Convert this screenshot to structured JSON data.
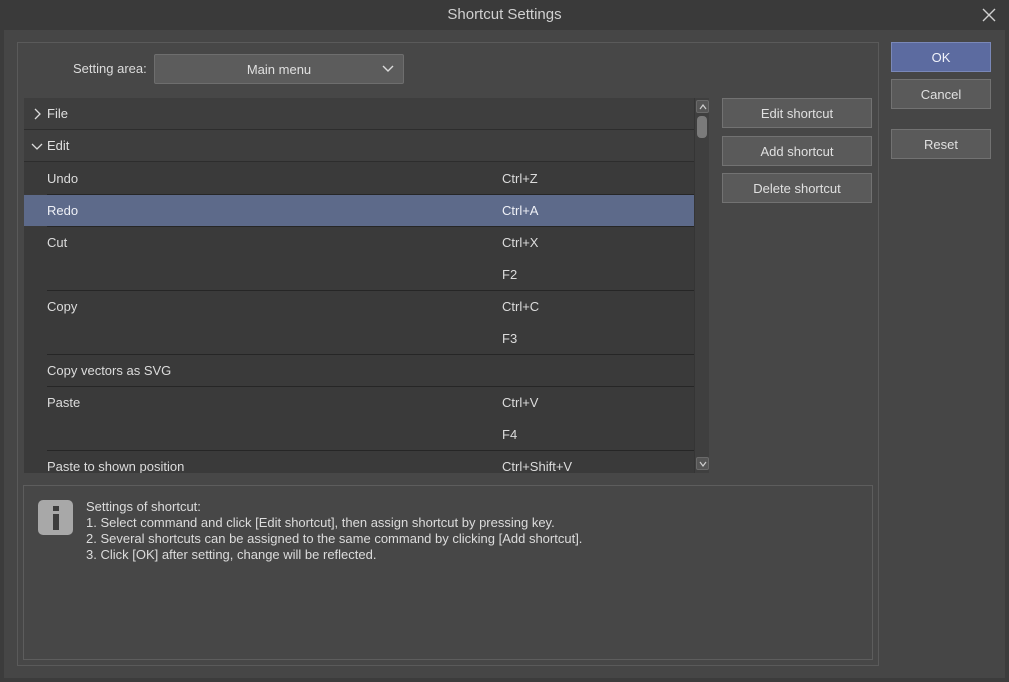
{
  "window": {
    "title": "Shortcut Settings"
  },
  "setting_area": {
    "label": "Setting area:",
    "selected": "Main menu"
  },
  "groups": [
    {
      "name": "File",
      "expanded": false
    },
    {
      "name": "Edit",
      "expanded": true
    }
  ],
  "commands": [
    {
      "name": "Undo",
      "shortcut": "Ctrl+Z"
    },
    {
      "name": "Redo",
      "shortcut": "Ctrl+A",
      "selected": true
    },
    {
      "name": "Cut",
      "shortcut": "Ctrl+X"
    },
    {
      "name": "",
      "shortcut": "F2"
    },
    {
      "name": "Copy",
      "shortcut": "Ctrl+C"
    },
    {
      "name": "",
      "shortcut": "F3"
    },
    {
      "name": "Copy vectors as SVG",
      "shortcut": ""
    },
    {
      "name": "Paste",
      "shortcut": "Ctrl+V"
    },
    {
      "name": "",
      "shortcut": "F4"
    },
    {
      "name": "Paste to shown position",
      "shortcut": "Ctrl+Shift+V"
    }
  ],
  "actions": {
    "edit": "Edit shortcut",
    "add": "Add shortcut",
    "delete": "Delete shortcut"
  },
  "dialog_buttons": {
    "ok": "OK",
    "cancel": "Cancel",
    "reset": "Reset"
  },
  "info": {
    "lines": [
      "Settings of shortcut:",
      "1. Select command and click [Edit shortcut], then assign shortcut by pressing key.",
      "2. Several shortcuts can be assigned to the same command by clicking [Add shortcut].",
      "3. Click [OK] after setting, change will be reflected."
    ]
  },
  "colors": {
    "accent": "#5c6ba0",
    "selection": "#5d6a8a",
    "background": "#3c3c3c"
  }
}
